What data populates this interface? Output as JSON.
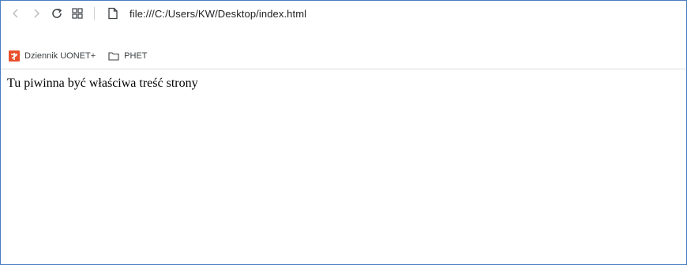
{
  "browser": {
    "address_bar": {
      "url": "file:///C:/Users/KW/Desktop/index.html"
    },
    "nav": {
      "back_icon": "chevron-left-icon",
      "forward_icon": "chevron-right-icon",
      "reload_icon": "reload-icon",
      "apps_icon": "apps-grid-icon",
      "page_icon": "file-icon"
    },
    "bookmarks": [
      {
        "label": "Dziennik UONET+",
        "icon": "uonet-favicon"
      },
      {
        "label": "PHET",
        "icon": "folder-icon"
      }
    ],
    "colors": {
      "window_border": "#4a7cc0",
      "uonet_favicon": "#e8502b"
    }
  },
  "page": {
    "body_text": "Tu piwinna być właściwa treść strony"
  }
}
